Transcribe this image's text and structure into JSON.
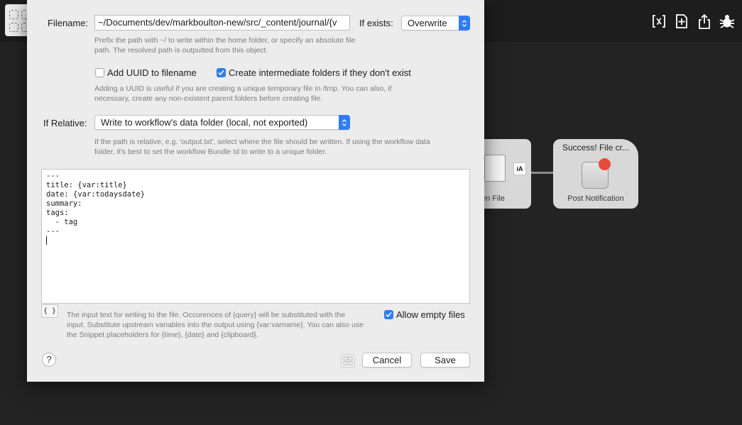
{
  "dialog": {
    "filename_label": "Filename:",
    "filename_value": "~/Documents/dev/markboulton-new/src/_content/journal/{v",
    "if_exists_label": "If exists:",
    "if_exists_value": "Overwrite",
    "filename_help": "Prefix the path with ~/ to write within the home folder, or specify an absolute file path. The resolved path is outputted from this object.",
    "uuid_label": "Add UUID to filename",
    "uuid_checked": false,
    "folders_label": "Create intermediate folders if they don't exist",
    "folders_checked": true,
    "uuid_help": "Adding a UUID is useful if you are creating a unique temporary file in /tmp. You can also, if necessary, create any non-existent parent folders before creating file.",
    "relative_label": "If Relative:",
    "relative_value": "Write to workflow's data folder (local, not exported)",
    "relative_help": "If the path is relative, e.g. 'output.txt', select where the file should be written. If using the workflow data folder, it's best to set the workflow Bundle Id to write to a unique folder.",
    "editor_lines": [
      "---",
      "title: {var:title}",
      "date: {var:todaysdate}",
      "summary:",
      "tags:",
      "  - tag",
      "---"
    ],
    "brace_label": "{ }",
    "input_help": "The input text for writing to the file. Occurences of {query} will be substituted with the input. Substitute upstream variables into the output using {var:varname}. You can also use the Snippet placeholders for {time}, {date} and {clipboard}.",
    "allow_empty_label": "Allow empty files",
    "allow_empty_checked": true,
    "help_button": "?",
    "cancel_label": "Cancel",
    "save_label": "Save"
  },
  "canvas": {
    "open_file_label": "en File",
    "ia_badge": "iA",
    "notify_title": "Success! File cr...",
    "notify_label": "Post Notification"
  },
  "toolbar": {
    "icons": [
      "variable-icon",
      "add-document-icon",
      "share-icon",
      "debug-bug-icon"
    ]
  },
  "colors": {
    "accent": "#2f7cf6",
    "notification_dot": "#e74c3c",
    "background": "#232323"
  }
}
